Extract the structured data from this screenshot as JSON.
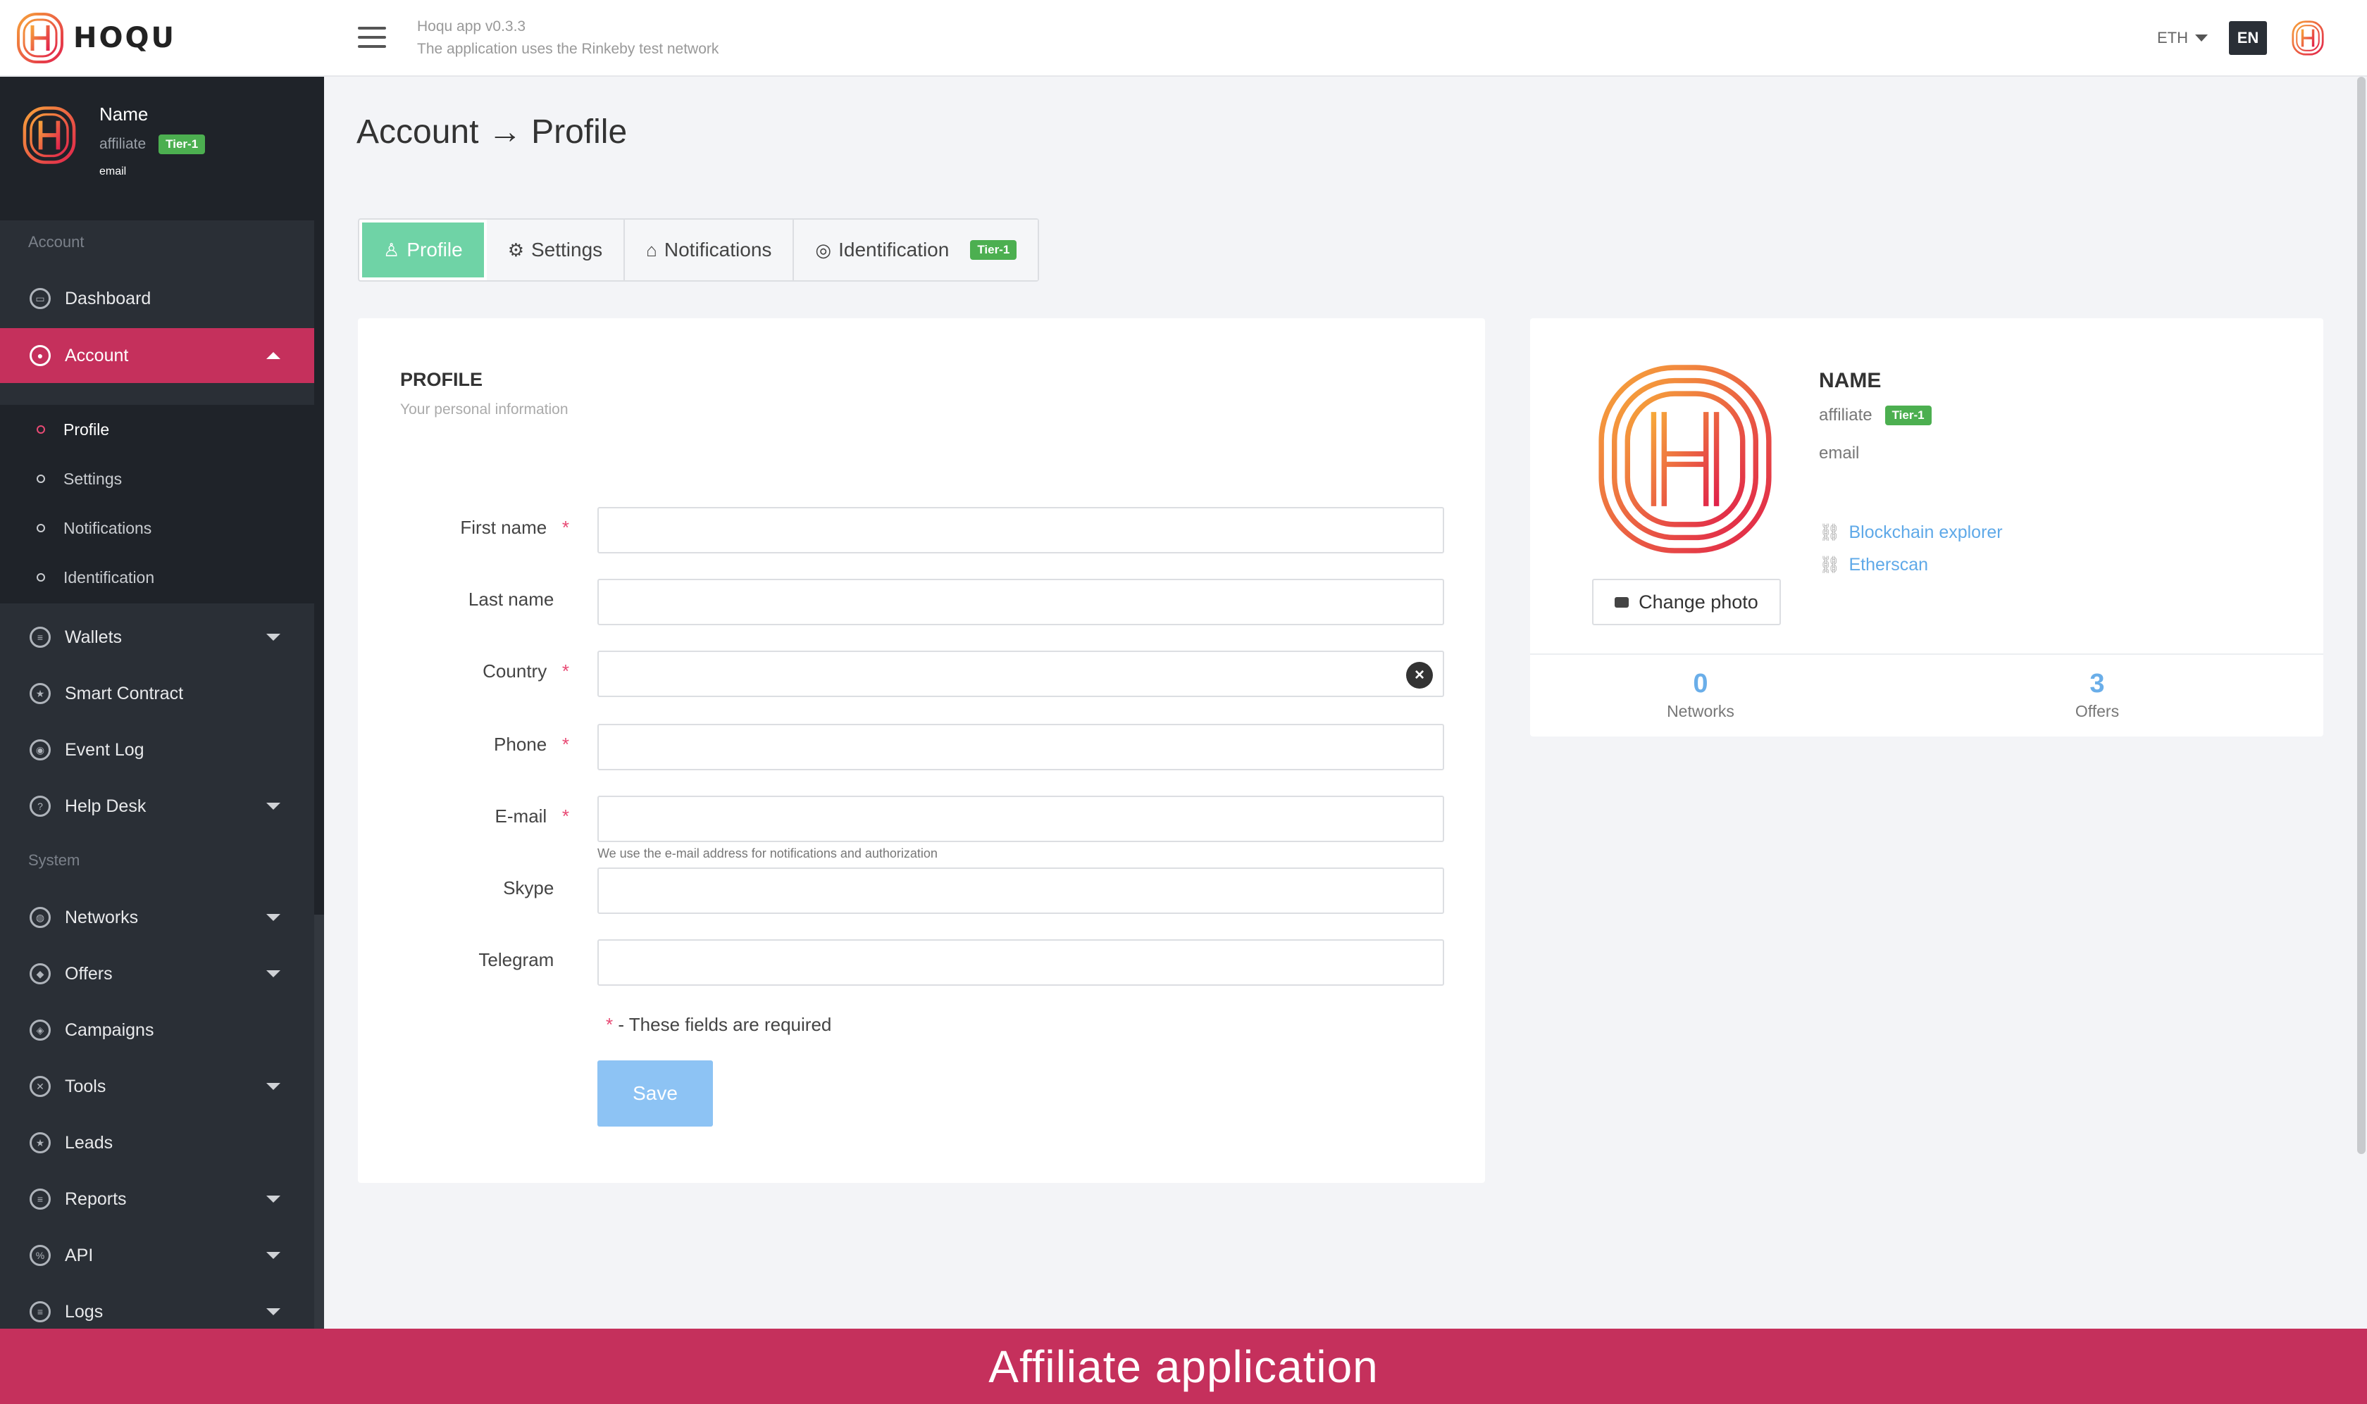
{
  "app": {
    "brand": "HOQU",
    "version": "Hoqu app v0.3.3",
    "network_note": "The application uses the Rinkeby test network"
  },
  "topbar": {
    "currency": "ETH",
    "language": "EN"
  },
  "user": {
    "name": "Name",
    "role": "affiliate",
    "tier": "Tier-1",
    "email": "email"
  },
  "sidebar": {
    "account_section": "Account",
    "system_section": "System",
    "items": [
      {
        "label": "Dashboard",
        "icon": "monitor-icon"
      },
      {
        "label": "Account",
        "icon": "user-circle-icon"
      },
      {
        "label": "Wallets",
        "icon": "wallet-icon"
      },
      {
        "label": "Smart Contract",
        "icon": "star-icon"
      },
      {
        "label": "Event Log",
        "icon": "target-icon"
      },
      {
        "label": "Help Desk",
        "icon": "help-icon"
      },
      {
        "label": "Networks",
        "icon": "globe-icon"
      },
      {
        "label": "Offers",
        "icon": "tag-icon"
      },
      {
        "label": "Campaigns",
        "icon": "layers-icon"
      },
      {
        "label": "Tools",
        "icon": "tools-icon"
      },
      {
        "label": "Leads",
        "icon": "star-icon"
      },
      {
        "label": "Reports",
        "icon": "report-icon"
      },
      {
        "label": "API",
        "icon": "api-icon"
      },
      {
        "label": "Logs",
        "icon": "list-icon"
      }
    ],
    "account_sub": [
      {
        "label": "Profile"
      },
      {
        "label": "Settings"
      },
      {
        "label": "Notifications"
      },
      {
        "label": "Identification"
      }
    ]
  },
  "page": {
    "title": "Account → Profile"
  },
  "tabs": [
    {
      "label": "Profile",
      "icon": "user-icon"
    },
    {
      "label": "Settings",
      "icon": "gear-icon"
    },
    {
      "label": "Notifications",
      "icon": "inbox-icon"
    },
    {
      "label": "Identification",
      "icon": "eye-icon",
      "badge": "Tier-1"
    }
  ],
  "profile_form": {
    "title": "PROFILE",
    "subtitle": "Your personal information",
    "fields": [
      {
        "label": "First name",
        "required": "*",
        "value": ""
      },
      {
        "label": "Last name",
        "required": "",
        "value": ""
      },
      {
        "label": "Country",
        "required": "*",
        "value": ""
      },
      {
        "label": "Phone",
        "required": "*",
        "value": ""
      },
      {
        "label": "E-mail",
        "required": "*",
        "value": ""
      },
      {
        "label": "Skype",
        "required": "",
        "value": ""
      },
      {
        "label": "Telegram",
        "required": "",
        "value": ""
      }
    ],
    "email_hint": "We use the e-mail address for notifications and authorization",
    "required_star": "*",
    "required_note": " - These fields are required",
    "save_label": "Save"
  },
  "side_card": {
    "name": "NAME",
    "role": "affiliate",
    "tier": "Tier-1",
    "email": "email",
    "change_photo": "Change photo",
    "links": [
      "Blockchain explorer",
      "Etherscan"
    ],
    "stats": [
      {
        "value": "0",
        "label": "Networks"
      },
      {
        "value": "3",
        "label": "Offers"
      }
    ]
  },
  "footer": {
    "text": "Affiliate application"
  },
  "colors": {
    "accent": "#c5305c",
    "tab_active": "#6fd3a6",
    "tier_badge": "#4caf50",
    "link": "#5fa9e8",
    "save_button": "#8dc3f4"
  }
}
